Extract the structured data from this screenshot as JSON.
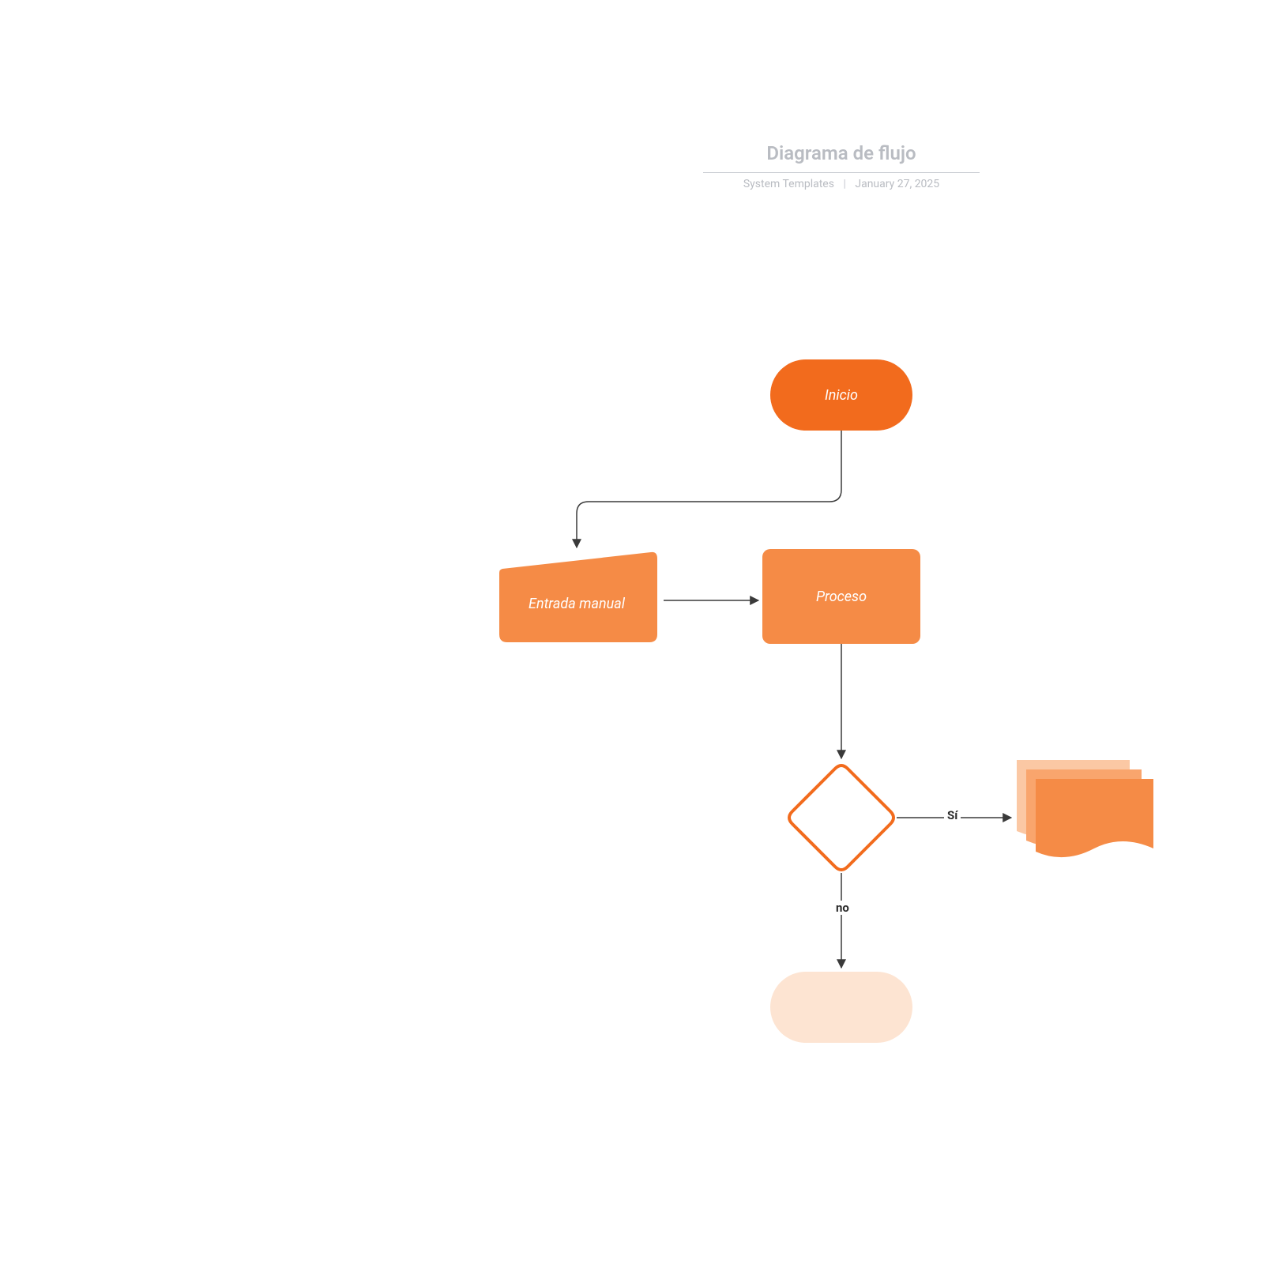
{
  "header": {
    "title": "Diagrama de flujo",
    "author": "System Templates",
    "date": "January 27, 2025"
  },
  "nodes": {
    "start": {
      "label": "Inicio",
      "type": "terminator"
    },
    "manual_input": {
      "label": "Entrada manual",
      "type": "manual-input"
    },
    "process": {
      "label": "Proceso",
      "type": "process"
    },
    "decision": {
      "label": "",
      "type": "decision"
    },
    "multidoc": {
      "label": "",
      "type": "multi-document"
    },
    "end": {
      "label": "",
      "type": "terminator"
    }
  },
  "edges": {
    "start_to_manual": {
      "from": "start",
      "to": "manual_input",
      "label": ""
    },
    "manual_to_process": {
      "from": "manual_input",
      "to": "process",
      "label": ""
    },
    "process_to_decision": {
      "from": "process",
      "to": "decision",
      "label": ""
    },
    "decision_yes": {
      "from": "decision",
      "to": "multidoc",
      "label": "Sí"
    },
    "decision_no": {
      "from": "decision",
      "to": "end",
      "label": "no"
    }
  },
  "colors": {
    "orange_dark": "#f26b1d",
    "orange_mid": "#f58b46",
    "orange_light": "#f9a56d",
    "orange_pale": "#fde4d2",
    "stroke": "#3a3a3a",
    "header_gray": "#b9bcc2"
  }
}
